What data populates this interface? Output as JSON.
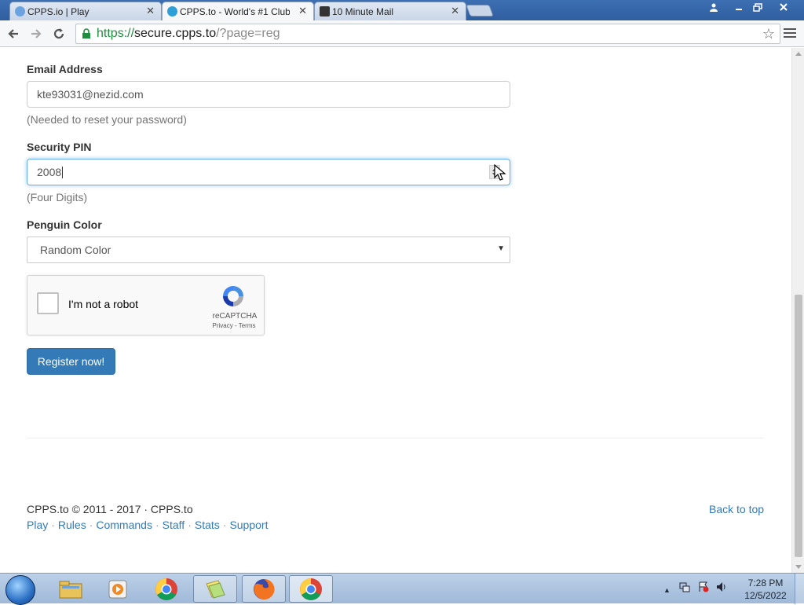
{
  "browser": {
    "tabs": [
      {
        "title": "CPPS.io | Play",
        "close": "✕"
      },
      {
        "title": "CPPS.to - World's #1 Club",
        "close": "✕"
      },
      {
        "title": "10 Minute Mail",
        "close": "✕"
      }
    ],
    "url": {
      "scheme": "https://",
      "host": "secure.cpps.to",
      "path": "/?page=reg"
    }
  },
  "form": {
    "email": {
      "label": "Email Address",
      "value": "kte93031@nezid.com",
      "help": "(Needed to reset your password)"
    },
    "pin": {
      "label": "Security PIN",
      "value": "2008",
      "help": "(Four Digits)"
    },
    "color": {
      "label": "Penguin Color",
      "selected": "Random Color"
    },
    "captcha": {
      "label": "I'm not a robot",
      "brand": "reCAPTCHA",
      "links": "Privacy - Terms"
    },
    "submit": "Register now!"
  },
  "footer": {
    "copyright": "CPPS.to © 2011 - 2017 · CPPS.to",
    "links": [
      "Play",
      "Rules",
      "Commands",
      "Staff",
      "Stats",
      "Support"
    ],
    "back_to_top": "Back to top"
  },
  "taskbar": {
    "time": "7:28 PM",
    "date": "12/5/2022",
    "tray_arrow": "▲"
  },
  "colors": {
    "primary": "#337ab7",
    "secure_green": "#1e8e3e",
    "focus": "#66afe9"
  }
}
